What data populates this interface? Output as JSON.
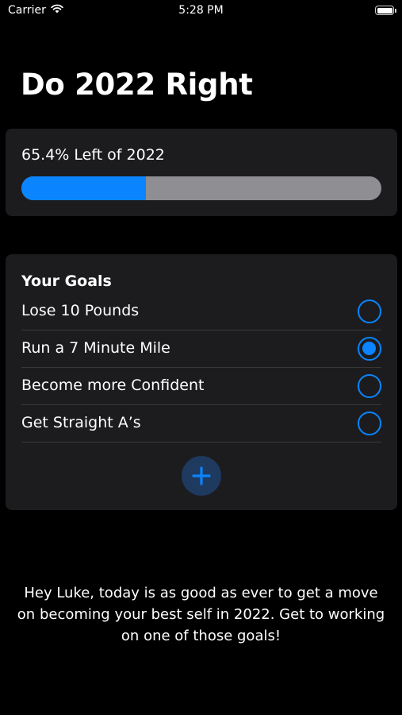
{
  "status_bar": {
    "carrier": "Carrier",
    "time": "5:28 PM"
  },
  "title": "Do 2022 Right",
  "progress": {
    "label": "65.4% Left of 2022",
    "fill_fraction": 0.346,
    "fill_color": "#0a84ff",
    "track_color": "#8e8e93"
  },
  "goals": {
    "header": "Your Goals",
    "items": [
      {
        "label": "Lose 10 Pounds",
        "completed": false
      },
      {
        "label": "Run a 7 Minute Mile",
        "completed": true
      },
      {
        "label": "Become more Confident",
        "completed": false
      },
      {
        "label": "Get Straight A’s",
        "completed": false
      }
    ],
    "add_icon": "plus-icon"
  },
  "message": "Hey Luke, today is as good as ever to get a move on becoming your best self in 2022. Get to working on one of those goals!",
  "colors": {
    "accent": "#0a84ff",
    "background": "#000000",
    "card": "#1c1c1e"
  }
}
